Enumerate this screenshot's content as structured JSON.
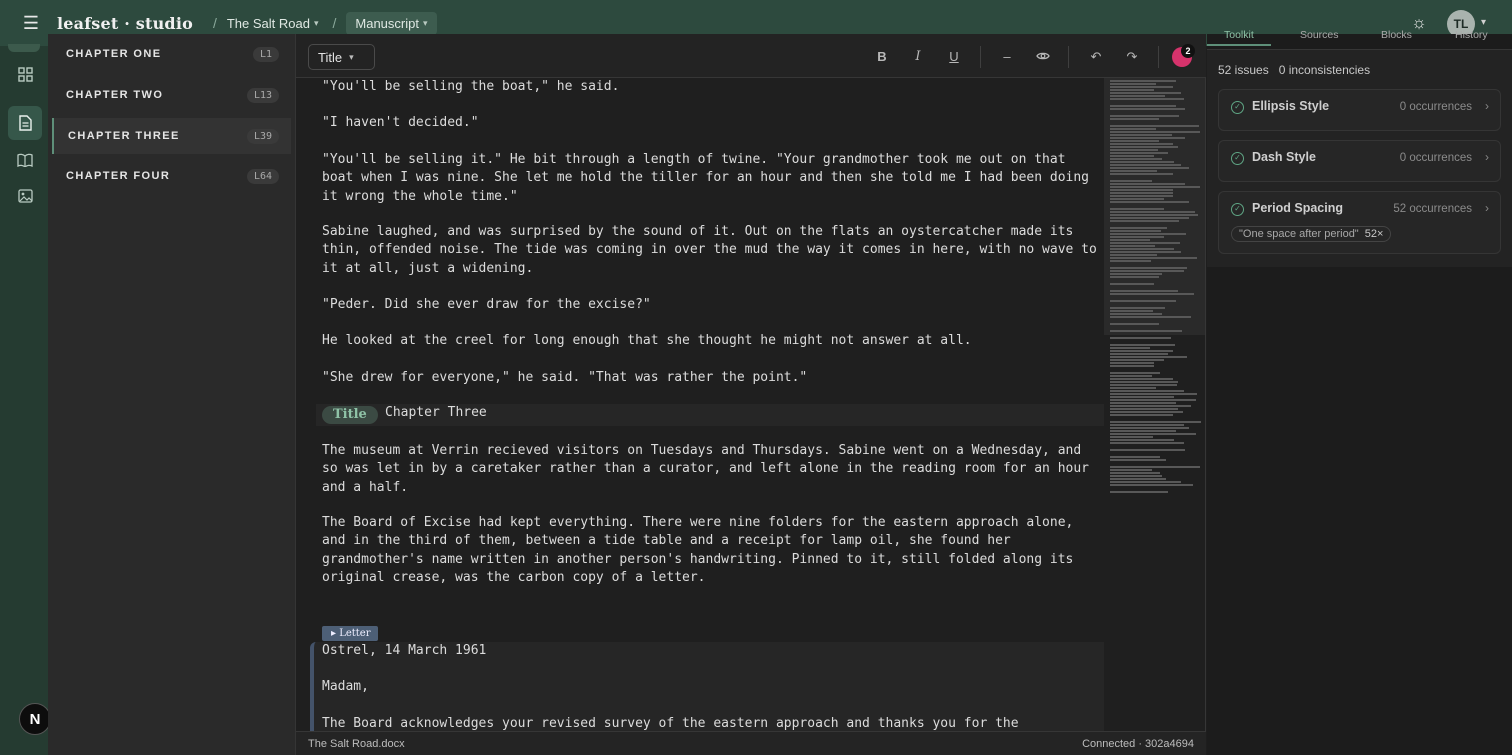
{
  "app": {
    "logo": "leafset · studio",
    "breadcrumb": [
      {
        "label": "The Salt Road"
      },
      {
        "label": "Manuscript"
      }
    ],
    "user_initials": "TL"
  },
  "chapters": [
    {
      "name": "CHAPTER ONE",
      "line": "L1"
    },
    {
      "name": "CHAPTER TWO",
      "line": "L13"
    },
    {
      "name": "CHAPTER THREE",
      "line": "L39"
    },
    {
      "name": "CHAPTER FOUR",
      "line": "L64"
    }
  ],
  "toolbar": {
    "block_style": "Title",
    "collab_count": "2"
  },
  "document": {
    "paragraphs": [
      "\"You'll be selling the boat,\" he said.",
      "\"I haven't decided.\"",
      "\"You'll be selling it.\" He bit through a length of twine. \"Your grandmother took me out on that boat when I was nine. She let me hold the tiller for an hour and then she told me I had been doing it wrong the whole time.\"",
      "Sabine laughed, and was surprised by the sound of it. Out on the flats an oystercatcher made its thin, offended noise. The tide was coming in over the mud the way it comes in here, with no wave to it at all, just a widening.",
      "\"Peder. Did she ever draw for the excise?\"",
      "He looked at the creel for long enough that she thought he might not answer at all.",
      "\"She drew for everyone,\" he said. \"That was rather the point.\"",
      "The museum at Verrin recieved visitors on Tuesdays and Thursdays. Sabine went on a Wednesday, and so was let in by a caretaker rather than a curator, and left alone in the reading room for an hour and a half.",
      "The Board of Excise had kept everything. There were nine folders for the eastern approach alone, and in the third of them, between a tide table and a receipt for lamp oil, she found her grandmother's name written in another person's handwriting. Pinned to it, still folded along its original crease, was the carbon copy of a letter."
    ],
    "title_tag": "Title",
    "title_text": "Chapter Three",
    "letter_tag": "▸ Letter",
    "letter_lines": [
      "Ostrel, 14 March 1961",
      "Madam,",
      "The Board acknowledges your revised survey of the eastern approach and thanks you for the"
    ]
  },
  "status": {
    "file": "The Salt Road.docx",
    "connection": "Connected · 302a4694"
  },
  "panel": {
    "tabs": [
      "Toolkit",
      "Sources",
      "Blocks",
      "History"
    ],
    "issues": "52 issues",
    "inconsistencies": "0 inconsistencies",
    "rules": [
      {
        "name": "Ellipsis Style",
        "count": "0 occurrences"
      },
      {
        "name": "Dash Style",
        "count": "0 occurrences"
      },
      {
        "name": "Period Spacing",
        "count": "52 occurrences",
        "detail": "\"One space after period\"",
        "detail_count": "52×"
      }
    ]
  }
}
